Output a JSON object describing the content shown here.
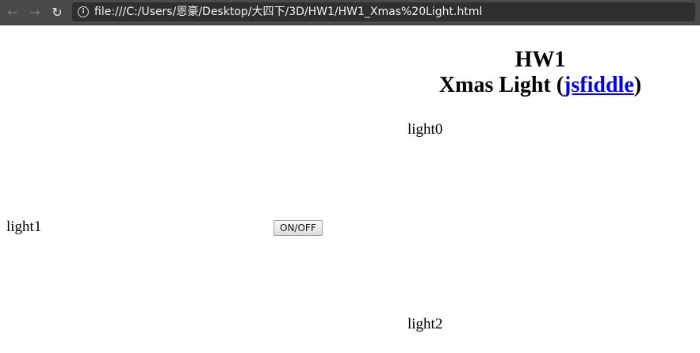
{
  "browser": {
    "back_icon": "arrow-left-icon",
    "forward_icon": "arrow-right-icon",
    "reload_icon": "reload-icon",
    "info_icon": "info-icon",
    "url": "file:///C:/Users/恩豪/Desktop/大四下/3D/HW1/HW1_Xmas%20Light.html"
  },
  "page": {
    "title_line1": "HW1",
    "title_line2_prefix": "Xmas Light (",
    "title_link": "jsfiddle",
    "title_line2_suffix": ")",
    "light0": "light0",
    "light1": "light1",
    "light2": "light2",
    "onoff_button": "ON/OFF"
  },
  "colors": {
    "link": "#0000ee",
    "toolbar": "#4a4a4a"
  }
}
